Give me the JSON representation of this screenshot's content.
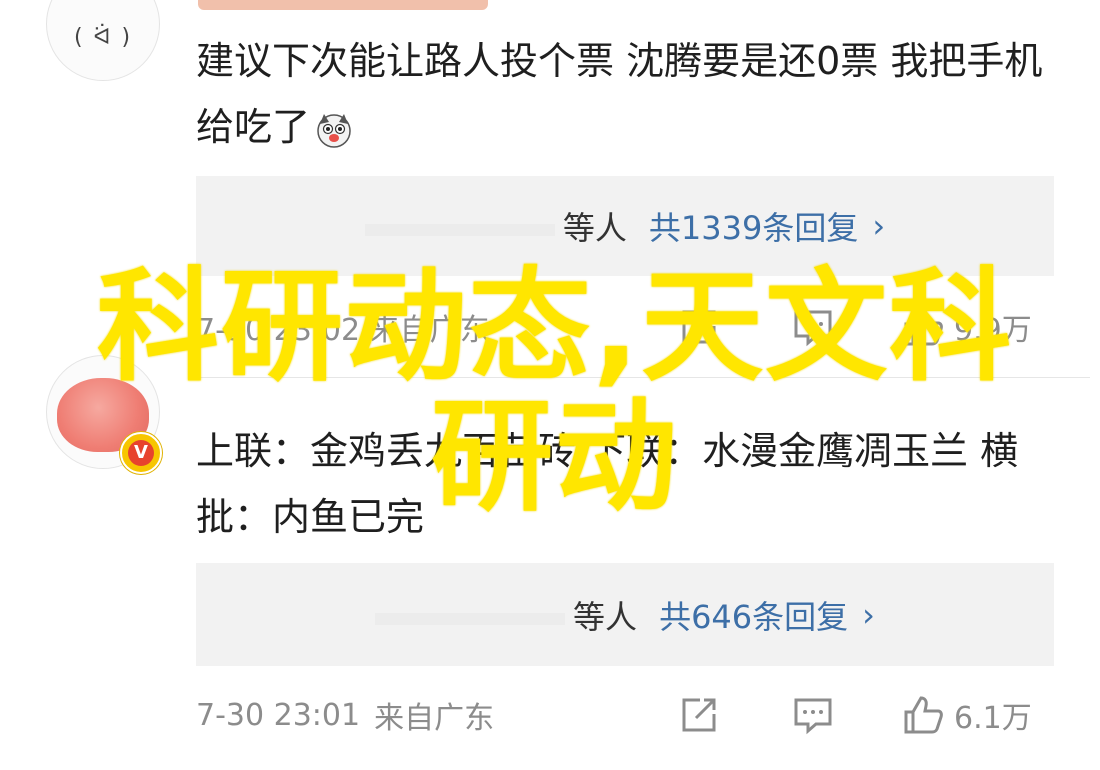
{
  "comments": [
    {
      "text": "建议下次能让路人投个票 沈腾要是还0票 我把手机给吃了",
      "emoji": "dog-emoji",
      "replies": {
        "names_suffix": "等人",
        "count_text": "共1339条回复",
        "arrow": "›"
      },
      "meta": {
        "time_source": "7-30 23:02 来自广东",
        "likes": "9.9万"
      }
    },
    {
      "text": "上联：金鸡丢九百苗砖 下联：水漫金鹰凋玉兰 横批：内鱼已完",
      "badge": "V",
      "replies": {
        "names_suffix": "等人",
        "count_text": "共646条回复",
        "arrow": "›"
      },
      "meta": {
        "time": "7-30 23:01",
        "source": "来自广东",
        "likes": "6.1万"
      }
    }
  ],
  "avatar_face": "( ᐛ )",
  "watermark": {
    "line1": "科研动态,天文科",
    "line2": "研动"
  },
  "colors": {
    "link": "#3d6fa7",
    "watermark": "#ffe600",
    "reply_bg": "#f2f2f2",
    "meta": "#8c8c8c"
  },
  "icons": [
    "share-icon",
    "comment-icon",
    "like-icon"
  ]
}
